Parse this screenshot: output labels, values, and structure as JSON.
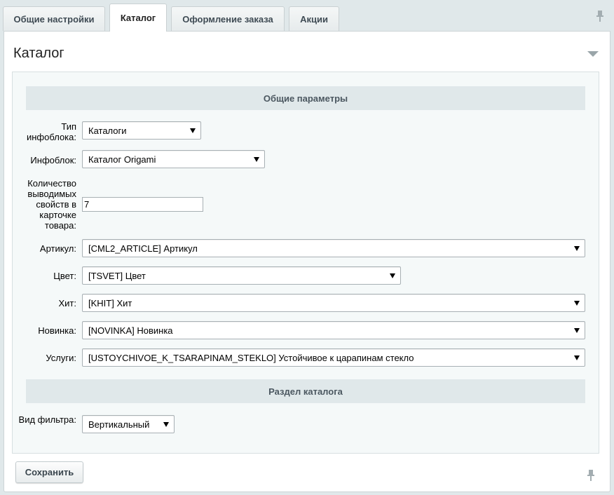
{
  "tabs": [
    {
      "label": "Общие настройки",
      "active": false
    },
    {
      "label": "Каталог",
      "active": true
    },
    {
      "label": "Оформление заказа",
      "active": false
    },
    {
      "label": "Акции",
      "active": false
    }
  ],
  "panel": {
    "title": "Каталог"
  },
  "sections": {
    "general": "Общие параметры",
    "catalog_section": "Раздел каталога"
  },
  "fields": {
    "iblock_type": {
      "label": "Тип инфоблока:",
      "value": "Каталоги"
    },
    "iblock": {
      "label": "Инфоблок:",
      "value": "Каталог Origami"
    },
    "props_count": {
      "label": "Количество выводимых свойств в карточке товара:",
      "value": "7"
    },
    "article": {
      "label": "Артикул:",
      "value": "[CML2_ARTICLE] Артикул"
    },
    "color": {
      "label": "Цвет:",
      "value": "[TSVET] Цвет"
    },
    "hit": {
      "label": "Хит:",
      "value": "[KHIT] Хит"
    },
    "novelty": {
      "label": "Новинка:",
      "value": "[NOVINKA] Новинка"
    },
    "services": {
      "label": "Услуги:",
      "value": "[USTOYCHIVOE_K_TSARAPINAM_STEKLO] Устойчивое к царапинам стекло"
    },
    "filter_view": {
      "label": "Вид фильтра:",
      "value": "Вертикальный"
    }
  },
  "footer": {
    "save_label": "Сохранить"
  },
  "colors": {
    "page_bg": "#e0e8ea",
    "section_bg": "#e0e8ea",
    "content_bg": "#f5f9f9"
  },
  "icons": {
    "pin": "pin-icon",
    "collapse": "chevron-down-icon",
    "select_arrow": "caret-down-icon"
  }
}
